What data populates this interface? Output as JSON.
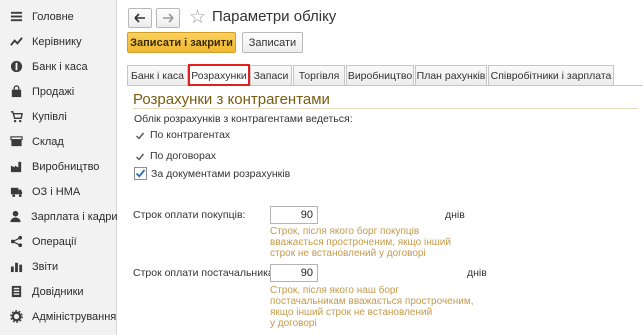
{
  "sidebar": {
    "items": [
      {
        "label": "Головне",
        "icon": "menu-icon"
      },
      {
        "label": "Керівнику",
        "icon": "trend-icon"
      },
      {
        "label": "Банк і каса",
        "icon": "coin-icon"
      },
      {
        "label": "Продажі",
        "icon": "bag-icon"
      },
      {
        "label": "Купівлі",
        "icon": "cart-icon"
      },
      {
        "label": "Склад",
        "icon": "box-icon"
      },
      {
        "label": "Виробництво",
        "icon": "factory-icon"
      },
      {
        "label": "ОЗ і НМА",
        "icon": "truck-icon"
      },
      {
        "label": "Зарплата і кадри",
        "icon": "person-icon"
      },
      {
        "label": "Операції",
        "icon": "nodes-icon"
      },
      {
        "label": "Звіти",
        "icon": "barchart-icon"
      },
      {
        "label": "Довідники",
        "icon": "book-icon"
      },
      {
        "label": "Адміністрування",
        "icon": "gear-icon"
      }
    ]
  },
  "header": {
    "title": "Параметри обліку",
    "save_close_label": "Записати і закрити",
    "save_label": "Записати"
  },
  "tabs": [
    {
      "label": "Банк і каса"
    },
    {
      "label": "Розрахунки"
    },
    {
      "label": "Запаси"
    },
    {
      "label": "Торгівля"
    },
    {
      "label": "Виробництво"
    },
    {
      "label": "План рахунків"
    },
    {
      "label": "Співробітники і зарплата"
    }
  ],
  "settlements": {
    "section_title": "Розрахунки з контрагентами",
    "intro": "Облік розрахунків з контрагентами ведеться:",
    "opt_contractors": "По контрагентах",
    "opt_contracts": "По договорах",
    "opt_documents": "За документами розрахунків",
    "opt_documents_checked": true,
    "buyers_label": "Строк оплати покупців:",
    "buyers_value": "90",
    "buyers_unit": "днів",
    "buyers_hint": [
      "Строк, після якого борг покупців",
      "вважається простроченим, якщо інший",
      "строк не встановлений у договорі"
    ],
    "suppliers_label": "Строк оплати постачальникам:",
    "suppliers_value": "90",
    "suppliers_unit": "днів",
    "suppliers_hint": [
      "Строк, після якого наш борг",
      "постачальникам вважається простроченим,",
      "якщо інший строк не встановлений",
      "у договорі"
    ]
  },
  "colors": {
    "accent": "#f0b632",
    "active_tab_outline": "#e0201c",
    "section_title": "#7a5c12",
    "hint_text": "#c49a4a"
  }
}
